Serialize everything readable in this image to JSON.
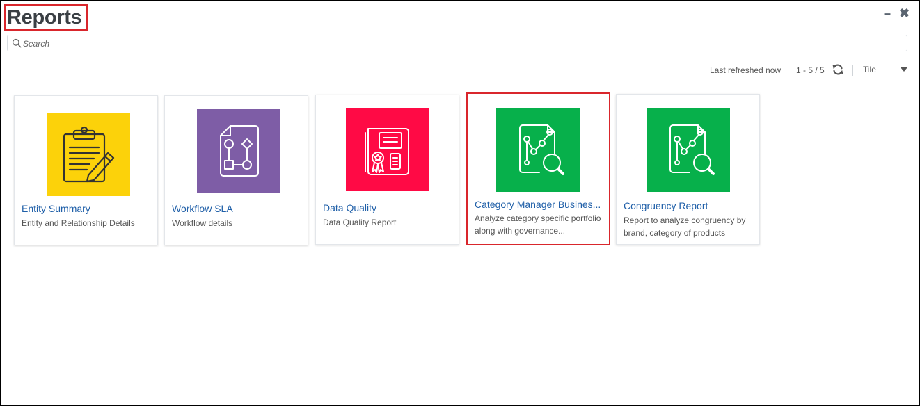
{
  "window": {
    "title": "Reports",
    "minimize_icon": "minimize-icon",
    "close_icon": "close-icon"
  },
  "search": {
    "placeholder": "Search",
    "value": "",
    "icon": "search-icon"
  },
  "toolbar": {
    "refresh_status": "Last refreshed now",
    "count": "1 - 5 / 5",
    "refresh_icon": "refresh-icon",
    "view_mode": "Tile"
  },
  "colors": {
    "title_highlight": "#d9262c",
    "link": "#1f5fa8",
    "tile_yellow": "#fcd20a",
    "tile_purple": "#7e5da6",
    "tile_red": "#ff0a45",
    "tile_green": "#07b04b"
  },
  "reports": [
    {
      "title": "Entity Summary",
      "description": "Entity and Relationship Details",
      "icon": "clipboard-pen-icon",
      "color": "#fcd20a"
    },
    {
      "title": "Workflow SLA",
      "description": "Workflow details",
      "icon": "workflow-document-icon",
      "color": "#7e5da6"
    },
    {
      "title": "Data Quality",
      "description": "Data Quality Report",
      "icon": "certificate-report-icon",
      "color": "#ff0a45"
    },
    {
      "title": "Category Manager Busines...",
      "description": "Analyze category specific portfolio along with governance...",
      "icon": "chart-magnifier-icon",
      "color": "#07b04b",
      "selected": true
    },
    {
      "title": "Congruency Report",
      "description": "Report to analyze congruency by brand, category of products",
      "icon": "chart-magnifier-icon",
      "color": "#07b04b"
    }
  ]
}
